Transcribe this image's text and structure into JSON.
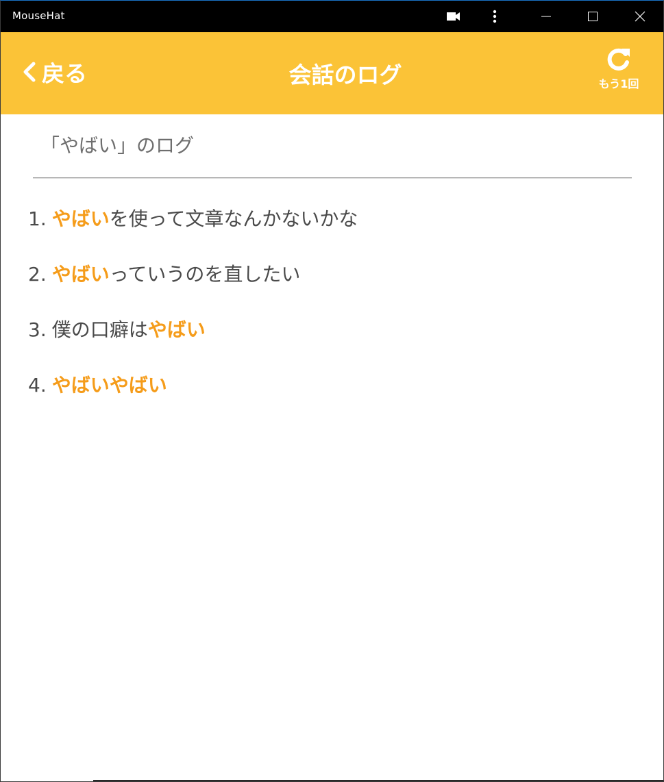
{
  "window": {
    "app_title": "MouseHat"
  },
  "titlebar_icons": {
    "camera": "video-camera-icon",
    "more": "more-vertical-icon",
    "minimize": "minimize-icon",
    "maximize": "maximize-icon",
    "close": "close-icon"
  },
  "header": {
    "back_label": "戻る",
    "title": "会話のログ",
    "retry_label": "もう1回",
    "background_color": "#fbc337",
    "back_icon": "chevron-left-icon",
    "retry_icon": "refresh-icon"
  },
  "content": {
    "section_title": "「やばい」のログ",
    "highlight_color": "#f59c1a",
    "items": [
      {
        "number": "1.",
        "segments": [
          {
            "text": "やばい",
            "highlight": true
          },
          {
            "text": "を使って文章なんかないかな",
            "highlight": false
          }
        ]
      },
      {
        "number": "2.",
        "segments": [
          {
            "text": "やばい",
            "highlight": true
          },
          {
            "text": "っていうのを直したい",
            "highlight": false
          }
        ]
      },
      {
        "number": "3.",
        "segments": [
          {
            "text": "僕の口癖は",
            "highlight": false
          },
          {
            "text": "やばい",
            "highlight": true
          }
        ]
      },
      {
        "number": "4.",
        "segments": [
          {
            "text": "やばいやばい",
            "highlight": true
          }
        ]
      }
    ]
  }
}
